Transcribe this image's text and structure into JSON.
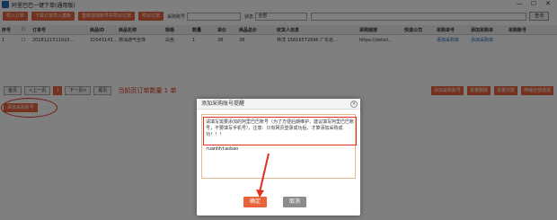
{
  "window": {
    "title": "阿里巴巴一键下单(通用版)",
    "minimize": "—",
    "maximize": "☐",
    "close": "✕"
  },
  "toolbar": {
    "buttons": [
      "导入订单",
      "下载订单导入模板",
      "重新选择账号并导出订单",
      "导出订单"
    ],
    "account_label": "采购账号",
    "account_value": "",
    "status_label": "状态",
    "status_value": "全部",
    "search_placeholder": "",
    "search_button": "查询"
  },
  "grid": {
    "columns": [
      "序号",
      "",
      "订单号",
      "商品ID",
      "商品名称",
      "规格",
      "数量",
      "单价",
      "商品总价",
      "收货人信息",
      "采购链接",
      "快递公司",
      "采购单号",
      "添加采购单",
      "采购账号"
    ],
    "row": [
      "1",
      "",
      "2018121511910…",
      "32043143…",
      "燃油通气全饰",
      "白色",
      "1",
      "28",
      "28",
      "林洋 15816572896 广东省…",
      "https://detail…",
      "",
      "添加采购单",
      "添加采购单",
      ""
    ]
  },
  "pager": {
    "first": "首页",
    "prev": "<上一页",
    "page": "1",
    "next": "下一页>",
    "last": "尾页",
    "count_text": "当前页订单数量 1 单",
    "right_buttons": [
      "添加采购账号",
      "批量删除",
      "批量付款",
      "伸缩全部选择"
    ]
  },
  "left": {
    "add_account_button": "添加采购账号"
  },
  "dialog": {
    "title": "添加采购账号提醒",
    "close": "×",
    "note": "请填写需要添加的阿里巴巴账号（为了方便后期维护，建议填写阿里巴巴账号，不要填写手机号），注意：只有网页登录成功后，才算添加采购成功！！！",
    "account": "ruanhhtaobao",
    "ok": "确定",
    "cancel": "取消"
  },
  "colors": {
    "accent": "#e8623a",
    "highlight": "#e0301e",
    "link": "#1a5fb4"
  }
}
